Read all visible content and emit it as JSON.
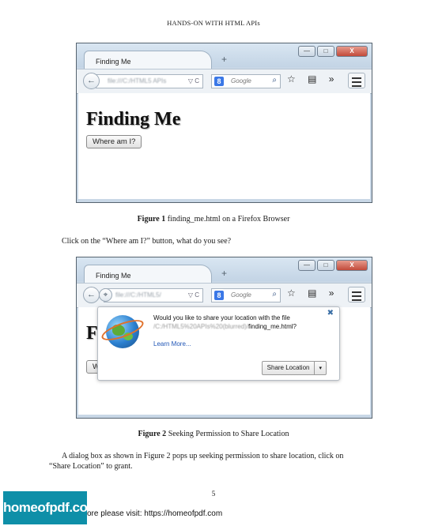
{
  "header": "HANDS-ON WITH HTML APIs",
  "browser": {
    "tab_title": "Finding Me",
    "new_tab_symbol": "+",
    "window_controls": {
      "minimize": "—",
      "maximize": "□",
      "close": "X"
    },
    "back_icon": "←",
    "url_fig1": "file:///C:/HTML5 APIs",
    "url_fig2": "file:///C:/HTML5/",
    "url_suffix": "▽ C",
    "search_engine_letter": "8",
    "search_placeholder": "Google",
    "search_icon": "⌕",
    "toolbar_icons": "☆ ▤ »"
  },
  "figure1": {
    "heading": "Finding Me",
    "button_label": "Where am I?",
    "caption_label": "Figure 1",
    "caption_text": "finding_me.html on a Firefox Browser"
  },
  "paragraph1": "Click on the “Where am I?” button, what do you see?",
  "figure2": {
    "heading_partial": "F",
    "button_partial": "W",
    "popup": {
      "message_line1": "Would you like to share your location with the file",
      "message_path": "/C:/HTML5%20APIs%20(blurred)/",
      "message_file": "finding_me.html?",
      "learn_more": "Learn More...",
      "share_button": "Share Location",
      "dropdown": "▾",
      "close": "✖"
    },
    "caption_label": "Figure 2",
    "caption_text": "Seeking Permission to Share Location"
  },
  "paragraph2_line1": "A dialog box as shown in Figure 2 pops up seeking permission to share location, click on",
  "paragraph2_line2": "“Share Location” to grant.",
  "page_number": "5",
  "footer": {
    "logo_text": "homeofpdf.com",
    "text": "ore please visit: https://homeofpdf.com"
  }
}
